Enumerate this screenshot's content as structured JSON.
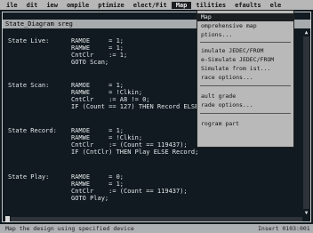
{
  "menubar": {
    "items": [
      "ile",
      "dit",
      "iew",
      "ompile",
      "ptimize",
      "elect/Fit",
      "Map",
      "tilities",
      "efaults",
      "ele"
    ],
    "active_index": 6
  },
  "editor": {
    "title": "State_Diagram  sreg",
    "blocks": [
      {
        "label": "State Live:",
        "lines": [
          "RAMOE     = 1;",
          "RAMWE     = 1;",
          "CntClr    := 1;",
          "GOTO Scan;"
        ]
      },
      {
        "label": "State Scan:",
        "lines": [
          "RAMOE     = 1;",
          "RAMWE     = !Clkin;",
          "CntClr    := A8 != 0;",
          "IF (Count == 127) THEN Record ELSE Scan;"
        ]
      },
      {
        "label": "State Record:",
        "lines": [
          "RAMOE     = 1;",
          "RAMWE     = !Clkin;",
          "CntClr    := (Count == 119437);",
          "IF (CntClr) THEN Play ELSE Record;"
        ]
      },
      {
        "label": "State Play:",
        "lines": [
          "RAMOE     = 0;",
          "RAMWE     = 1;",
          "CntClr    := (Count == 119437);",
          "GOTO Play;"
        ]
      }
    ]
  },
  "dropdown": {
    "items": [
      {
        "label": "Map",
        "selected": true
      },
      {
        "label": "omprehensive map",
        "selected": false
      },
      {
        "label": "ptions...",
        "selected": false
      },
      {
        "label": "imulate JEDEC/FROM",
        "selected": false
      },
      {
        "label": "e-Simulate JEDEC/FROM",
        "selected": false
      },
      {
        "label": "Simulate from  ist...",
        "selected": false
      },
      {
        "label": "race options...",
        "selected": false
      },
      {
        "label": "ault grade",
        "selected": false
      },
      {
        "label": "rade options...",
        "selected": false
      },
      {
        "label": "rogram part",
        "selected": false
      }
    ]
  },
  "statusbar": {
    "message": "Map the design using specified device",
    "position": "Insert 0103:001"
  },
  "colors": {
    "editor_bg": "#101a20",
    "menubar_bg": "#b7b7b7",
    "highlight_bg": "#1c1f22",
    "dropdown_bg": "#b9b9b9"
  }
}
